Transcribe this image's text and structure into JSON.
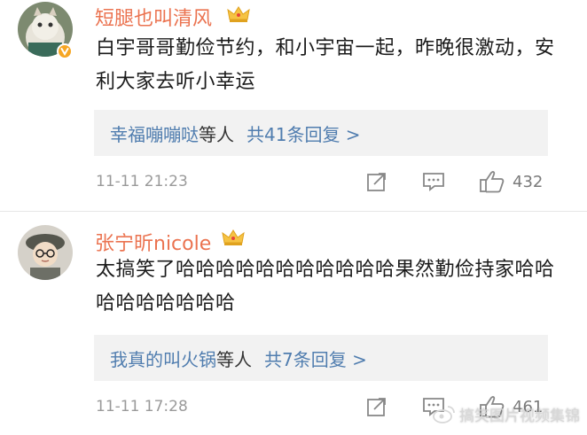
{
  "comments": [
    {
      "username": "短腿也叫清风",
      "text": "白宇哥哥勤俭节约，和小宇宙一起，昨晚很激动，安利大家去听小幸运",
      "reply_users": "幸福嘣嘣哒",
      "reply_suffix": "等人",
      "reply_count": "共41条回复 >",
      "time": "11-11 21:23",
      "likes": "432",
      "verified": true
    },
    {
      "username": "张宁昕nicole",
      "text": "太搞笑了哈哈哈哈哈哈哈哈哈哈哈果然勤俭持家哈哈哈哈哈哈哈哈哈",
      "reply_users": "我真的叫火锅",
      "reply_suffix": "等人",
      "reply_count": "共7条回复 >",
      "time": "11-11 17:28",
      "likes": "461",
      "verified": false
    }
  ],
  "watermark": {
    "text": "搞笑图片视频集锦"
  },
  "colors": {
    "username": "#eb7350",
    "link": "#507daf",
    "reply_bg": "#f2f2f2",
    "meta": "#9a9a9a",
    "crown": "#f6c343",
    "verified_badge": "#f6a623"
  },
  "icons": {
    "vip": "crown-icon",
    "share": "share-icon",
    "comment": "comment-icon",
    "like": "thumbs-up-icon"
  }
}
